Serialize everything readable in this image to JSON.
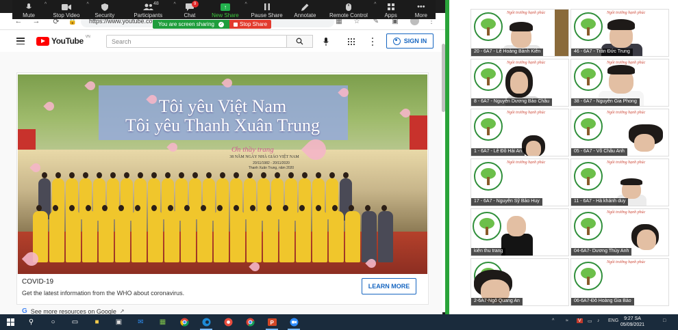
{
  "zoom_toolbar": {
    "items": [
      {
        "label": "Mute",
        "icon": "microphone-icon"
      },
      {
        "label": "Stop Video",
        "icon": "video-camera-icon"
      },
      {
        "label": "Security",
        "icon": "shield-icon"
      },
      {
        "label": "Participants",
        "icon": "participants-icon",
        "count": "48"
      },
      {
        "label": "Chat",
        "icon": "chat-icon",
        "badge": "9"
      },
      {
        "label": "New Share",
        "icon": "share-screen-icon"
      },
      {
        "label": "Pause Share",
        "icon": "pause-icon"
      },
      {
        "label": "Annotate",
        "icon": "pencil-icon"
      },
      {
        "label": "Remote Control",
        "icon": "mouse-icon"
      },
      {
        "label": "Apps",
        "icon": "apps-icon"
      },
      {
        "label": "More",
        "icon": "more-icon"
      }
    ],
    "sharing_banner": "You are screen sharing",
    "stop_share": "Stop Share"
  },
  "browser": {
    "url": "https://www.youtube.com"
  },
  "youtube": {
    "logo": "YouTube",
    "region": "VN",
    "search_placeholder": "Search",
    "sign_in": "SIGN IN",
    "banner": {
      "title_1": "Tôi yêu Việt Nam",
      "title_2": "Tôi yêu Thanh Xuân Trung",
      "subtitle": "38 NĂM NGÀY NHÀ GIÁO VIỆT NAM",
      "dates": "20/11/1982 - 20/11/2020",
      "script": "Ơn thầy trang",
      "small": "Thanh Xuân Trung, năm 2020"
    },
    "covid_title": "COVID-19",
    "covid_sub": "Get the latest information from the WHO about coronavirus.",
    "learn_more": "LEARN MORE",
    "more_resources": "See more resources on Google"
  },
  "gallery": {
    "script_text": "Ngôi trường hạnh phúc",
    "participants": [
      "20 - 6A7 - Lê Hoàng Bảnh Kiên",
      "46 - 6A7 - Trần Đức Trung",
      "8 - 6A7 - Nguyễn Dương Bảo Châu",
      "38 - 6A7 - Nguyễn Gia Phong",
      "1 - 6A7 - Lê Đỗ Hải An",
      "05 - 6A7 - Võ Châu Anh",
      "17 - 6A7 - Nguyễn Sỹ Bảo Huy",
      "11 - 6A7 - Hà khánh duy",
      "kiên thu trang",
      "04-6A7- Dương Thùy Anh",
      "2-6A7-Ngô Quang An",
      "06-6A7-Đỗ Hoàng Gia Bảo"
    ]
  },
  "taskbar": {
    "language": "ENG",
    "time": "9:27 SA",
    "date": "05/09/2021",
    "apps": [
      "start-icon",
      "search-icon",
      "cortana-icon",
      "task-view-icon",
      "file-explorer-icon",
      "store-icon",
      "mail-icon",
      "photos-icon",
      "chrome-icon",
      "edge-icon",
      "skype-icon",
      "chrome-alt-icon",
      "powerpoint-icon",
      "zoom-icon"
    ]
  }
}
